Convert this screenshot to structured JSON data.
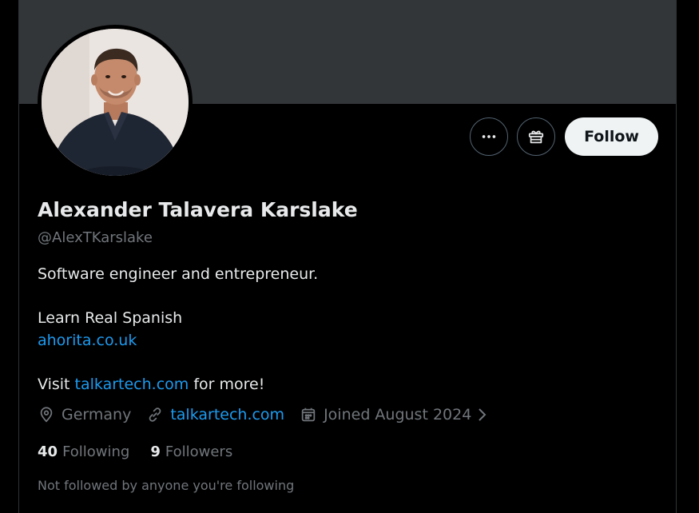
{
  "profile": {
    "display_name": "Alexander Talavera Karslake",
    "handle": "@AlexTKarslake",
    "avatar_icon": "profile-photo",
    "bio": {
      "line1": "Software engineer and entrepreneur.",
      "line2": "Learn Real Spanish",
      "link1": "ahorita.co.uk",
      "visit_prefix": "Visit ",
      "link2": "talkartech.com",
      "visit_suffix": " for more!"
    },
    "location": "Germany",
    "website": "talkartech.com",
    "joined": "Joined August 2024",
    "following_count": "40",
    "following_label": "Following",
    "followers_count": "9",
    "followers_label": "Followers",
    "not_followed_text": "Not followed by anyone you're following"
  },
  "actions": {
    "more_icon": "more-icon",
    "gift_icon": "gift-icon",
    "follow_label": "Follow"
  },
  "colors": {
    "background": "#000000",
    "banner": "#333639",
    "link": "#1d9bf0",
    "secondary_text": "#71767b",
    "primary_text": "#e7e9ea",
    "follow_button_bg": "#eff3f4"
  }
}
